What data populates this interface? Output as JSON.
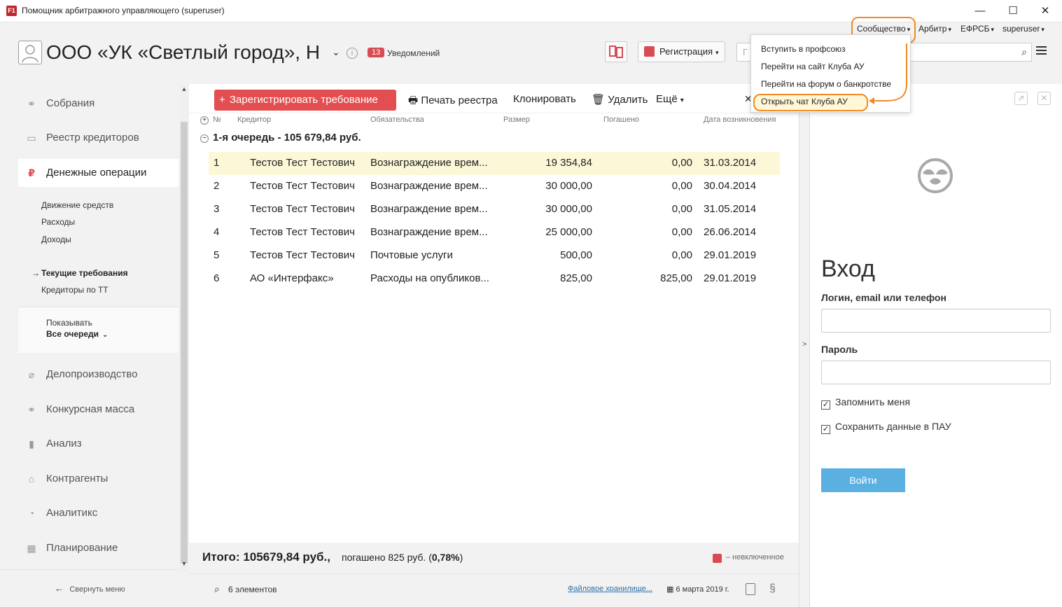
{
  "window": {
    "app_icon": "F1",
    "title": "Помощник арбитражного управляющего (superuser)",
    "controls": [
      "—",
      "☐",
      "✕"
    ]
  },
  "topnav": {
    "community": "Сообщество",
    "arbitr": "Арбитр",
    "efrsb": "ЕФРСБ",
    "user": "superuser"
  },
  "header": {
    "org_name": "ООО «УК «Светлый город», Н",
    "notifications_count": "13",
    "notifications_label": "Уведомлений",
    "registration_label": "Регистрация",
    "search_prefix": "Г"
  },
  "sidebar": {
    "items": [
      {
        "label": "Собрания",
        "icon": "handshake-icon"
      },
      {
        "label": "Реестр кредиторов",
        "icon": "id-card-icon"
      },
      {
        "label": "Денежные операции",
        "icon": "ruble-icon"
      },
      {
        "label": "Делопроизводство",
        "icon": "paperclip-icon"
      },
      {
        "label": "Конкурсная масса",
        "icon": "handshake-icon"
      },
      {
        "label": "Анализ",
        "icon": "bar-chart-icon"
      },
      {
        "label": "Контрагенты",
        "icon": "bank-icon"
      },
      {
        "label": "Аналитикс",
        "icon": "gauge-icon"
      },
      {
        "label": "Планирование",
        "icon": "calendar-icon"
      }
    ],
    "subitems": [
      "Движение средств",
      "Расходы",
      "Доходы",
      "Текущие требования",
      "Кредиторы по ТТ"
    ],
    "show_label": "Показывать",
    "show_value": "Все очереди",
    "collapse_label": "Свернуть меню"
  },
  "toolbar": {
    "register_label": "Зарегистрировать требование",
    "print_label": "Печать реестра",
    "clone_label": "Клонировать",
    "delete_label": "Удалить",
    "more_label": "Ещё"
  },
  "table": {
    "headers": [
      "№",
      "Кредитор",
      "Обязательства",
      "Размер",
      "Погашено",
      "Дата возникновения"
    ],
    "group_label": "1-я очередь -  105 679,84 руб.",
    "rows": [
      {
        "n": "1",
        "creditor": "Тестов Тест Тестович",
        "obligation": "Вознаграждение врем...",
        "size": "19 354,84",
        "paid": "0,00",
        "date": "31.03.2014"
      },
      {
        "n": "2",
        "creditor": "Тестов Тест Тестович",
        "obligation": "Вознаграждение врем...",
        "size": "30 000,00",
        "paid": "0,00",
        "date": "30.04.2014"
      },
      {
        "n": "3",
        "creditor": "Тестов Тест Тестович",
        "obligation": "Вознаграждение врем...",
        "size": "30 000,00",
        "paid": "0,00",
        "date": "31.05.2014"
      },
      {
        "n": "4",
        "creditor": "Тестов Тест Тестович",
        "obligation": "Вознаграждение врем...",
        "size": "25 000,00",
        "paid": "0,00",
        "date": "26.06.2014"
      },
      {
        "n": "5",
        "creditor": "Тестов Тест Тестович",
        "obligation": "Почтовые услуги",
        "size": "500,00",
        "paid": "0,00",
        "date": "29.01.2019"
      },
      {
        "n": "6",
        "creditor": "АО «Интерфакс»",
        "obligation": "Расходы  на опубликов...",
        "size": "825,00",
        "paid": "825,00",
        "date": "29.01.2019"
      }
    ]
  },
  "footer": {
    "total": "Итого: 105679,84 руб.,",
    "paid_prefix": "погашено 825 руб. (",
    "paid_percent": "0,78%",
    "paid_suffix": ")",
    "legend": "– невключенное",
    "count": "6 элементов",
    "files_link": "Файловое хранилище...",
    "date": "6 марта 2019 г."
  },
  "dropdown": {
    "items": [
      "Вступить в профсоюз",
      "Перейти на сайт Клуба АУ",
      "Перейти на форум о банкротстве",
      "Открыть чат Клуба АУ"
    ]
  },
  "login": {
    "title": "Вход",
    "login_label": "Логин, email или телефон",
    "password_label": "Пароль",
    "remember_label": "Запомнить меня",
    "save_label": "Сохранить данные в ПАУ",
    "submit_label": "Войти"
  },
  "colors": {
    "accent_red": "#e34e51",
    "highlight_orange": "#f08a24",
    "login_blue": "#5bb0e2",
    "selected_row": "#fcf7d7"
  }
}
